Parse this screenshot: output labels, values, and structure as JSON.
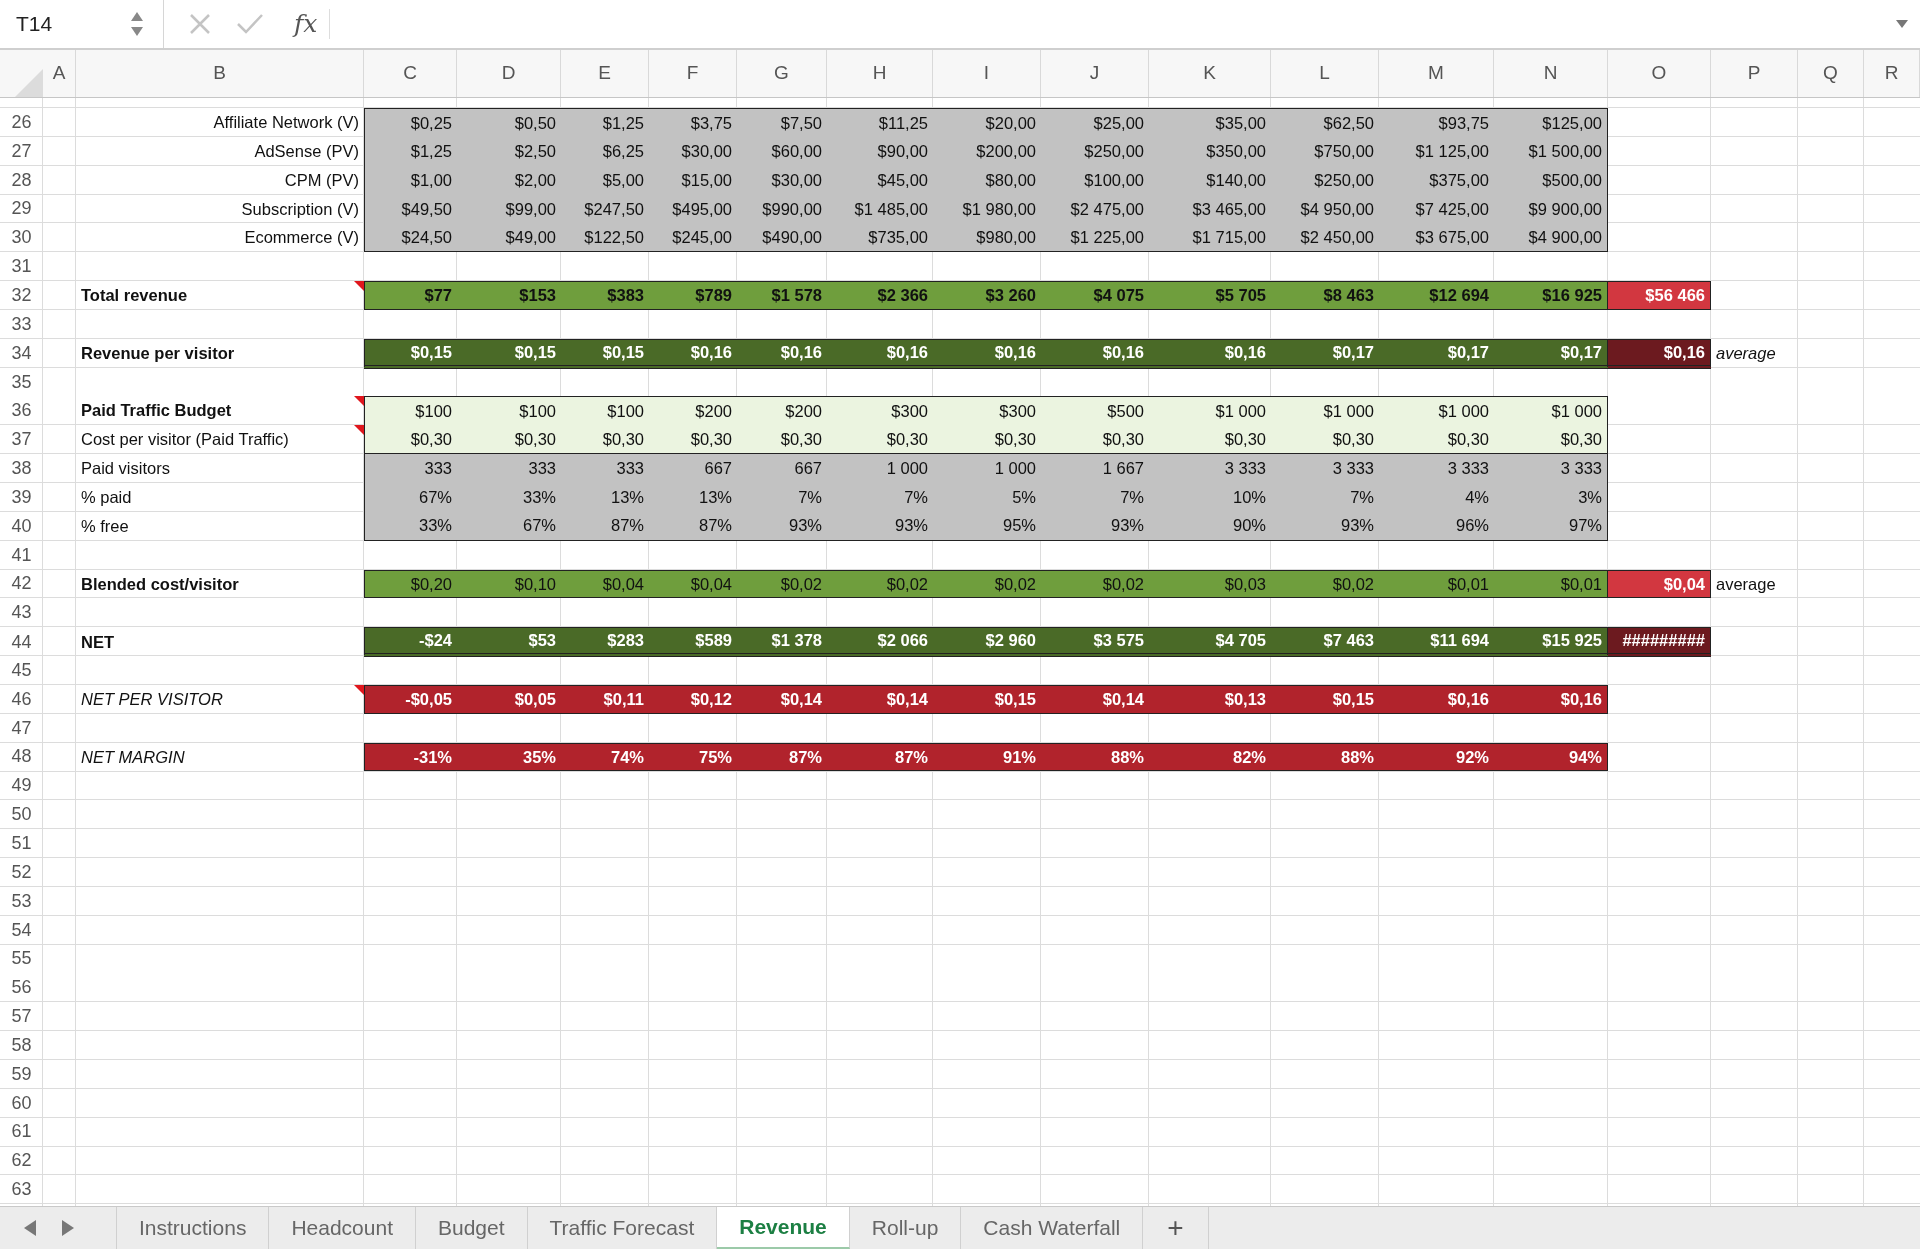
{
  "formula_bar": {
    "name_box": "T14",
    "function_label": "fx"
  },
  "columns": [
    "A",
    "B",
    "C",
    "D",
    "E",
    "F",
    "G",
    "H",
    "I",
    "J",
    "K",
    "L",
    "M",
    "N",
    "O",
    "P",
    "Q",
    "R"
  ],
  "rows": [
    {
      "number": "26",
      "kind": "input",
      "label": "Affiliate Network (V)",
      "bold": false,
      "italic": false,
      "comment": false,
      "cells": [
        "$0,25",
        "$0,50",
        "$1,25",
        "$3,75",
        "$7,50",
        "$11,25",
        "$20,00",
        "$25,00",
        "$35,00",
        "$62,50",
        "$93,75",
        "$125,00"
      ]
    },
    {
      "number": "27",
      "kind": "input",
      "label": "AdSense (PV)",
      "bold": false,
      "italic": false,
      "comment": false,
      "cells": [
        "$1,25",
        "$2,50",
        "$6,25",
        "$30,00",
        "$60,00",
        "$90,00",
        "$200,00",
        "$250,00",
        "$350,00",
        "$750,00",
        "$1 125,00",
        "$1 500,00"
      ]
    },
    {
      "number": "28",
      "kind": "input",
      "label": "CPM (PV)",
      "bold": false,
      "italic": false,
      "comment": false,
      "cells": [
        "$1,00",
        "$2,00",
        "$5,00",
        "$15,00",
        "$30,00",
        "$45,00",
        "$80,00",
        "$100,00",
        "$140,00",
        "$250,00",
        "$375,00",
        "$500,00"
      ]
    },
    {
      "number": "29",
      "kind": "input",
      "label": "Subscription (V)",
      "bold": false,
      "italic": false,
      "comment": false,
      "cells": [
        "$49,50",
        "$99,00",
        "$247,50",
        "$495,00",
        "$990,00",
        "$1 485,00",
        "$1 980,00",
        "$2 475,00",
        "$3 465,00",
        "$4 950,00",
        "$7 425,00",
        "$9 900,00"
      ]
    },
    {
      "number": "30",
      "kind": "input",
      "label": "Ecommerce (V)",
      "bold": false,
      "italic": false,
      "comment": false,
      "cells": [
        "$24,50",
        "$49,00",
        "$122,50",
        "$245,00",
        "$490,00",
        "$735,00",
        "$980,00",
        "$1 225,00",
        "$1 715,00",
        "$2 450,00",
        "$3 675,00",
        "$4 900,00"
      ]
    },
    {
      "number": "31"
    },
    {
      "number": "32",
      "kind": "total",
      "label": "Total revenue",
      "bold": true,
      "italic": false,
      "comment": true,
      "cells": [
        "$77",
        "$153",
        "$383",
        "$789",
        "$1 578",
        "$2 366",
        "$3 260",
        "$4 075",
        "$5 705",
        "$8 463",
        "$12 694",
        "$16 925"
      ],
      "total": {
        "text": "$56 466",
        "kind": "bright"
      }
    },
    {
      "number": "33"
    },
    {
      "number": "34",
      "kind": "rate",
      "label": "Revenue per visitor",
      "bold": true,
      "italic": false,
      "comment": false,
      "cells": [
        "$0,15",
        "$0,15",
        "$0,15",
        "$0,16",
        "$0,16",
        "$0,16",
        "$0,16",
        "$0,16",
        "$0,16",
        "$0,17",
        "$0,17",
        "$0,17"
      ],
      "total": {
        "text": "$0,16",
        "kind": "dark"
      },
      "note": {
        "text": "average",
        "italic": true
      }
    },
    {
      "number": "35"
    },
    {
      "number": "36",
      "kind": "budget",
      "label": "Paid Traffic Budget",
      "bold": true,
      "italic": false,
      "comment": true,
      "cells": [
        "$100",
        "$100",
        "$100",
        "$200",
        "$200",
        "$300",
        "$300",
        "$500",
        "$1 000",
        "$1 000",
        "$1 000",
        "$1 000"
      ]
    },
    {
      "number": "37",
      "kind": "budget",
      "label": "Cost per visitor (Paid Traffic)",
      "bold": false,
      "italic": false,
      "comment": true,
      "cells": [
        "$0,30",
        "$0,30",
        "$0,30",
        "$0,30",
        "$0,30",
        "$0,30",
        "$0,30",
        "$0,30",
        "$0,30",
        "$0,30",
        "$0,30",
        "$0,30"
      ]
    },
    {
      "number": "38",
      "kind": "grey",
      "label": "Paid visitors",
      "bold": false,
      "italic": false,
      "comment": false,
      "cells": [
        "333",
        "333",
        "333",
        "667",
        "667",
        "1 000",
        "1 000",
        "1 667",
        "3 333",
        "3 333",
        "3 333",
        "3 333"
      ]
    },
    {
      "number": "39",
      "kind": "grey",
      "label": "% paid",
      "bold": false,
      "italic": false,
      "comment": false,
      "cells": [
        "67%",
        "33%",
        "13%",
        "13%",
        "7%",
        "7%",
        "5%",
        "7%",
        "10%",
        "7%",
        "4%",
        "3%"
      ]
    },
    {
      "number": "40",
      "kind": "grey",
      "label": "% free",
      "bold": false,
      "italic": false,
      "comment": false,
      "cells": [
        "33%",
        "67%",
        "87%",
        "87%",
        "93%",
        "93%",
        "95%",
        "93%",
        "90%",
        "93%",
        "96%",
        "97%"
      ]
    },
    {
      "number": "41"
    },
    {
      "number": "42",
      "kind": "blended",
      "label": "Blended cost/visitor",
      "bold": true,
      "italic": false,
      "comment": false,
      "cells": [
        "$0,20",
        "$0,10",
        "$0,04",
        "$0,04",
        "$0,02",
        "$0,02",
        "$0,02",
        "$0,02",
        "$0,03",
        "$0,02",
        "$0,01",
        "$0,01"
      ],
      "total": {
        "text": "$0,04",
        "kind": "bright"
      },
      "note": {
        "text": "average",
        "italic": false
      }
    },
    {
      "number": "43"
    },
    {
      "number": "44",
      "kind": "net",
      "label": "NET",
      "bold": true,
      "italic": false,
      "comment": false,
      "cells": [
        "-$24",
        "$53",
        "$283",
        "$589",
        "$1 378",
        "$2 066",
        "$2 960",
        "$3 575",
        "$4 705",
        "$7 463",
        "$11 694",
        "$15 925"
      ],
      "total": {
        "text": "#########",
        "kind": "dark"
      }
    },
    {
      "number": "45"
    },
    {
      "number": "46",
      "kind": "red",
      "label": "NET PER VISITOR",
      "bold": false,
      "italic": true,
      "comment": true,
      "cells": [
        "-$0,05",
        "$0,05",
        "$0,11",
        "$0,12",
        "$0,14",
        "$0,14",
        "$0,15",
        "$0,14",
        "$0,13",
        "$0,15",
        "$0,16",
        "$0,16"
      ]
    },
    {
      "number": "47"
    },
    {
      "number": "48",
      "kind": "red",
      "label": "NET MARGIN",
      "bold": false,
      "italic": true,
      "comment": false,
      "cells": [
        "-31%",
        "35%",
        "74%",
        "75%",
        "87%",
        "87%",
        "91%",
        "88%",
        "82%",
        "88%",
        "92%",
        "94%"
      ]
    },
    {
      "number": "49"
    },
    {
      "number": "50"
    },
    {
      "number": "51"
    },
    {
      "number": "52"
    },
    {
      "number": "53"
    },
    {
      "number": "54"
    },
    {
      "number": "55"
    },
    {
      "number": "56"
    },
    {
      "number": "57"
    },
    {
      "number": "58"
    },
    {
      "number": "59"
    },
    {
      "number": "60"
    },
    {
      "number": "61"
    },
    {
      "number": "62"
    },
    {
      "number": "63"
    }
  ],
  "sheet_tabs": [
    {
      "label": "Instructions",
      "selected": false
    },
    {
      "label": "Headcount",
      "selected": false
    },
    {
      "label": "Budget",
      "selected": false
    },
    {
      "label": "Traffic Forecast",
      "selected": false
    },
    {
      "label": "Revenue",
      "selected": true
    },
    {
      "label": "Roll-up",
      "selected": false
    },
    {
      "label": "Cash Waterfall",
      "selected": false
    }
  ],
  "add_sheet": "+"
}
